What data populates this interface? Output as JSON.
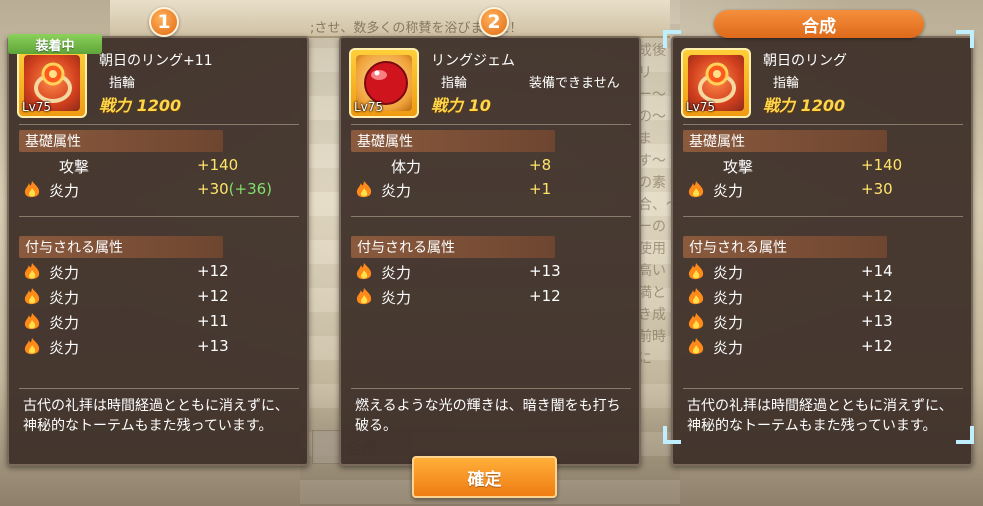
{
  "background": {
    "top_text": ";させ、数多くの称賛を浴びました！",
    "side_text": "成後リー〜の〜ます〜の素合、〜ーの使用高い満とき成前時に",
    "bottom_label": "合成"
  },
  "synth_header": "合成",
  "badges": [
    "1",
    "2"
  ],
  "panels": [
    {
      "equipped_label": "装着中",
      "item": {
        "name": "朝日のリング+11",
        "type": "指輪",
        "note": "",
        "level": "Lv75",
        "power": "戦力 1200",
        "icon": "sun-ring-icon"
      },
      "basic_title": "基礎属性",
      "basic_attrs": [
        {
          "name": "攻撃",
          "value": "+140",
          "bonus": "",
          "fire": false
        },
        {
          "name": "炎力",
          "value": "+30",
          "bonus": "(+36)",
          "fire": true
        }
      ],
      "extra_title": "付与される属性",
      "extra_attrs": [
        {
          "name": "炎力",
          "value": "+12"
        },
        {
          "name": "炎力",
          "value": "+12"
        },
        {
          "name": "炎力",
          "value": "+11"
        },
        {
          "name": "炎力",
          "value": "+13"
        }
      ],
      "description": "古代の礼拝は時間経過とともに消えずに、神秘的なトーテムもまた残っています。"
    },
    {
      "equipped_label": "",
      "item": {
        "name": "リングジェム",
        "type": "指輪",
        "note": "装備できません",
        "level": "Lv75",
        "power": "戦力 10",
        "icon": "red-gem-icon"
      },
      "basic_title": "基礎属性",
      "basic_attrs": [
        {
          "name": "体力",
          "value": "+8",
          "bonus": "",
          "fire": false
        },
        {
          "name": "炎力",
          "value": "+1",
          "bonus": "",
          "fire": true
        }
      ],
      "extra_title": "付与される属性",
      "extra_attrs": [
        {
          "name": "炎力",
          "value": "+13"
        },
        {
          "name": "炎力",
          "value": "+12"
        }
      ],
      "description": "燃えるような光の輝きは、暗き闇をも打ち破る。"
    },
    {
      "equipped_label": "",
      "item": {
        "name": "朝日のリング",
        "type": "指輪",
        "note": "",
        "level": "Lv75",
        "power": "戦力 1200",
        "icon": "sun-ring-icon"
      },
      "basic_title": "基礎属性",
      "basic_attrs": [
        {
          "name": "攻撃",
          "value": "+140",
          "bonus": "",
          "fire": false
        },
        {
          "name": "炎力",
          "value": "+30",
          "bonus": "",
          "fire": true
        }
      ],
      "extra_title": "付与される属性",
      "extra_attrs": [
        {
          "name": "炎力",
          "value": "+14"
        },
        {
          "name": "炎力",
          "value": "+12"
        },
        {
          "name": "炎力",
          "value": "+13"
        },
        {
          "name": "炎力",
          "value": "+12"
        }
      ],
      "description": "古代の礼拝は時間経過とともに消えずに、神秘的なトーテムもまた残っています。"
    }
  ],
  "confirm_label": "確定",
  "colors": {
    "power": "#ffd64a",
    "bonus": "#7fe06a",
    "accent": "#ef7d14",
    "equipped": "#6cb844"
  }
}
